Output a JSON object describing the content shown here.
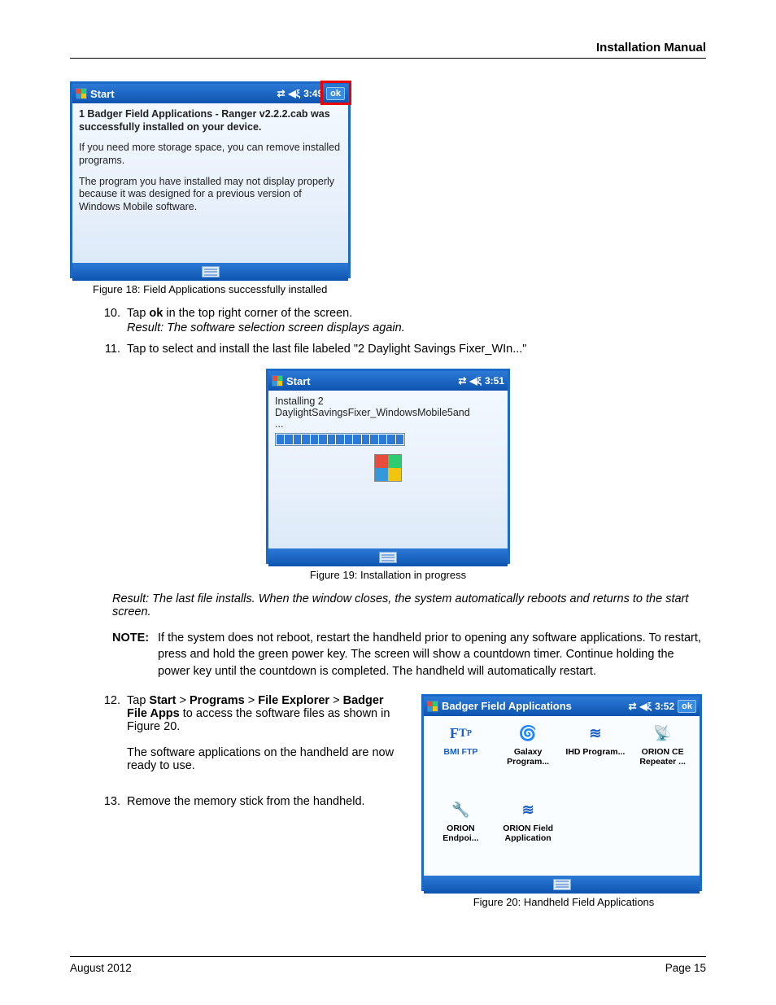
{
  "header": {
    "title": "Installation Manual"
  },
  "footer": {
    "date": "August 2012",
    "page": "Page 15"
  },
  "fig18": {
    "titlebar": "Start",
    "time": "3:49",
    "ok": "ok",
    "line1": "1 Badger Field Applications - Ranger v2.2.2.cab was successfully installed on your device.",
    "line2": "If you need more storage space, you can remove installed programs.",
    "line3": "The program you have installed may not display properly because it was designed for a previous version of Windows Mobile software.",
    "caption": "Figure 18:  Field Applications successfully installed"
  },
  "step10": {
    "num": "10.",
    "pre": "Tap  ",
    "bold": "ok",
    "post": " in the top right corner of the screen.",
    "result": "Result: The software selection screen displays again."
  },
  "step11": {
    "num": "11.",
    "text": "Tap to select and install the last file labeled \"2 Daylight Savings Fixer_WIn...\""
  },
  "fig19": {
    "titlebar": "Start",
    "time": "3:51",
    "line1": "Installing 2",
    "line2": "DaylightSavingsFixer_WindowsMobile5and",
    "line3": "...",
    "caption": "Figure 19:  Installation in progress"
  },
  "result_long": "Result: The last file installs. When the window closes, the system automatically reboots and returns to the start screen.",
  "note": {
    "label": "NOTE:",
    "text": "If the system does not reboot, restart the handheld prior to opening any software applications. To restart, press and hold the green power key. The screen will show a countdown timer. Continue holding the power key until the countdown is completed. The handheld will automatically restart."
  },
  "step12": {
    "num": "12.",
    "pre": "Tap ",
    "p1": "Start",
    "gt1": " > ",
    "p2": "Programs",
    "gt2": " > ",
    "p3": "File Explorer",
    "gt3": " > ",
    "p4": "Badger File Apps",
    "post": " to access the software files as shown in Figure 20.",
    "para2": "The software applications on the handheld are now ready to use."
  },
  "step13": {
    "num": "13.",
    "text": "Remove the memory stick from the handheld."
  },
  "fig20": {
    "titlebar": "Badger Field Applications",
    "time": "3:52",
    "ok": "ok",
    "apps": [
      {
        "name": "BMI FTP",
        "icon": "ftp"
      },
      {
        "name": "Galaxy Program...",
        "icon": "galaxy"
      },
      {
        "name": "IHD Program...",
        "icon": "wave"
      },
      {
        "name": "ORION CE Repeater ...",
        "icon": "sig"
      },
      {
        "name": "ORION Endpoi...",
        "icon": "ant"
      },
      {
        "name": "ORION Field Application",
        "icon": "wave"
      }
    ],
    "caption": "Figure 20:  Handheld Field Applications"
  }
}
